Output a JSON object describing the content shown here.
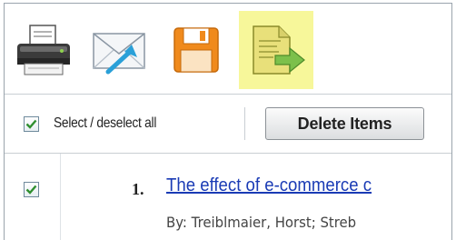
{
  "toolbar": {
    "items": [
      {
        "icon": "printer-icon",
        "action": "print"
      },
      {
        "icon": "envelope-icon",
        "action": "email"
      },
      {
        "icon": "floppy-disk-icon",
        "action": "save"
      },
      {
        "icon": "export-document-icon",
        "action": "export",
        "highlighted": true
      }
    ],
    "highlight_color": "#f7f79a"
  },
  "selection": {
    "select_all_label": "Select / deselect all",
    "select_all_checked": true,
    "delete_button_label": "Delete Items"
  },
  "results": [
    {
      "number": "1.",
      "checked": true,
      "title": "The effect of e-commerce c",
      "authors": "By: Treiblmaier, Horst; Streb"
    }
  ],
  "colors": {
    "link": "#1a3bb5",
    "checkmark": "#2f8f2f",
    "border": "#9aa4ad"
  }
}
